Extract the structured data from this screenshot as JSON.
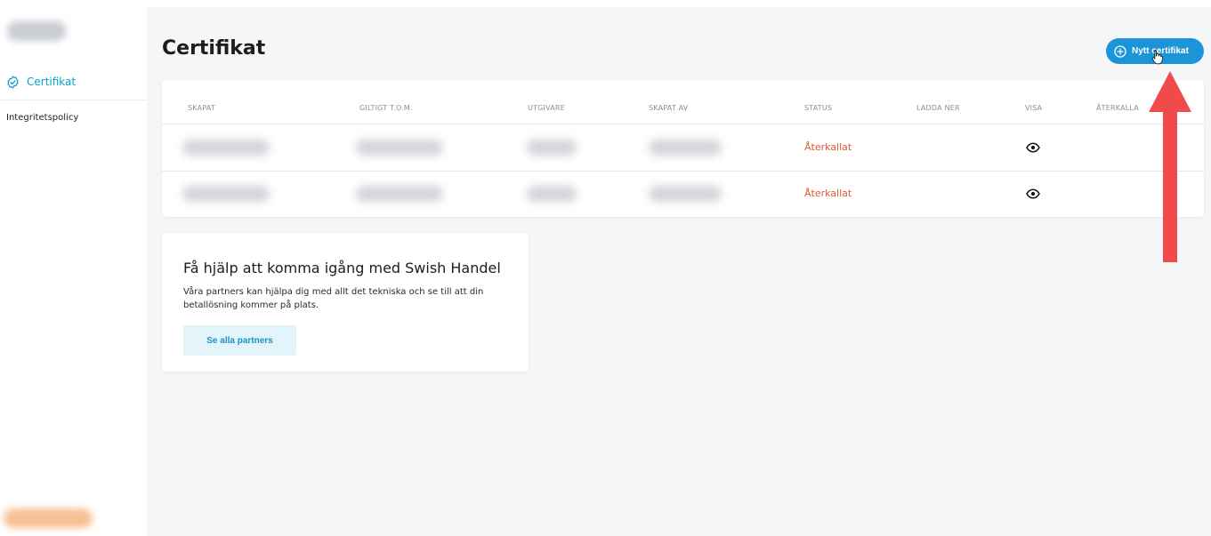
{
  "sidebar": {
    "items": [
      {
        "label": "Certifikat",
        "icon": "verified-check-icon",
        "active": true
      },
      {
        "label": "Integritetspolicy",
        "active": false
      }
    ]
  },
  "header": {
    "title": "Certifikat",
    "new_button_label": "Nytt certifikat"
  },
  "table": {
    "columns": [
      "SKAPAT",
      "GILTIGT T.O.M.",
      "UTGIVARE",
      "SKAPAT AV",
      "STATUS",
      "LADDA NER",
      "VISA",
      "ÅTERKALLA"
    ],
    "rows": [
      {
        "status": "Återkallat",
        "view_icon": "eye-icon"
      },
      {
        "status": "Återkallat",
        "view_icon": "eye-icon"
      }
    ]
  },
  "help_card": {
    "title": "Få hjälp att komma igång med Swish Handel",
    "text": "Våra partners kan hjälpa dig med allt det tekniska och se till att din betallösning kommer på plats.",
    "button_label": "Se alla partners"
  },
  "colors": {
    "accent": "#1b95d8",
    "sidebar_active": "#0aa2c8",
    "status_revoked": "#e2592a",
    "annotation_arrow": "#f04a4a"
  }
}
